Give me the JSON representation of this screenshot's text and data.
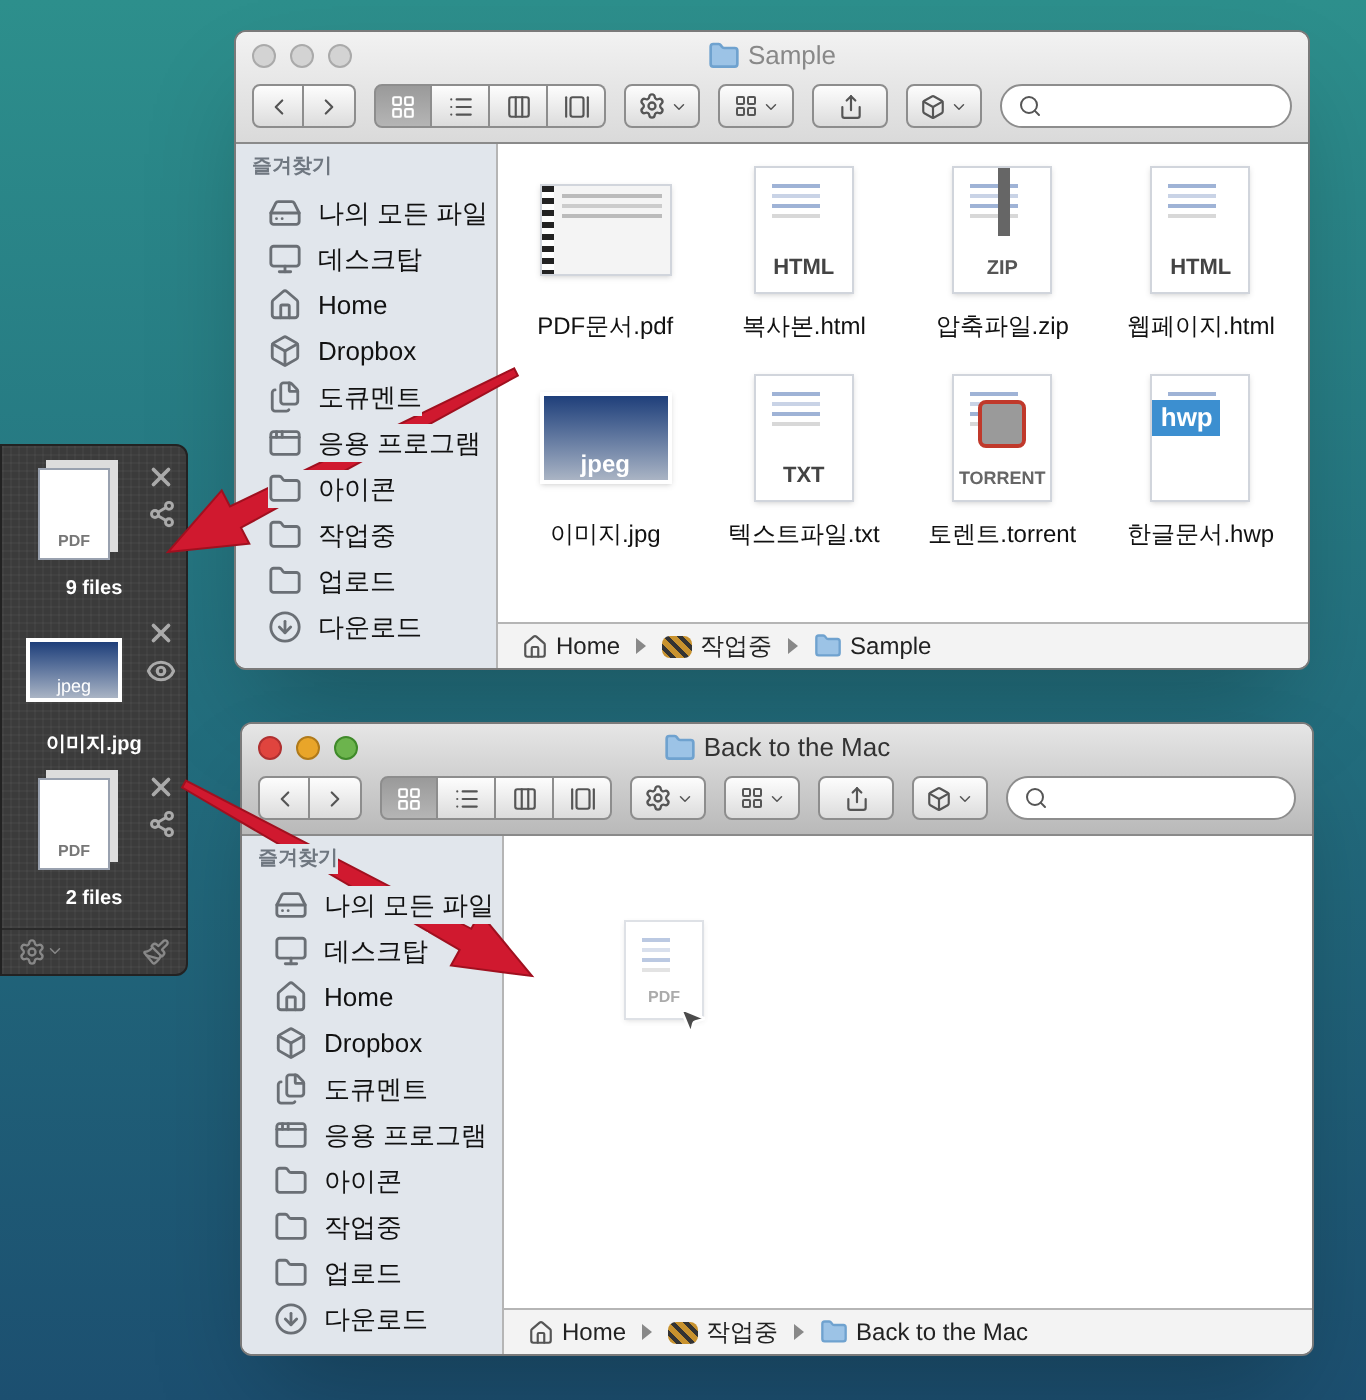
{
  "shelf": {
    "items": [
      {
        "kind": "stack",
        "badge": "PDF",
        "label": "9 files",
        "previewable": false
      },
      {
        "kind": "image",
        "badge": "jpeg",
        "label": "이미지.jpg",
        "previewable": true
      },
      {
        "kind": "stack",
        "badge": "PDF",
        "label": "2 files",
        "previewable": false
      }
    ]
  },
  "windows": [
    {
      "title": "Sample",
      "active": false,
      "view_modes": [
        {
          "selected": true
        },
        {
          "selected": false
        },
        {
          "selected": false
        },
        {
          "selected": false
        }
      ],
      "sidebar": {
        "header": "즐겨찾기",
        "items": [
          {
            "kind": "all-files",
            "label": "나의 모든 파일"
          },
          {
            "kind": "desktop",
            "label": "데스크탑"
          },
          {
            "kind": "home",
            "label": "Home"
          },
          {
            "kind": "dropbox",
            "label": "Dropbox"
          },
          {
            "kind": "documents",
            "label": "도큐멘트"
          },
          {
            "kind": "apps",
            "label": "응용 프로그램"
          },
          {
            "kind": "folder",
            "label": "아이콘"
          },
          {
            "kind": "folder",
            "label": "작업중"
          },
          {
            "kind": "folder",
            "label": "업로드"
          },
          {
            "kind": "downloads",
            "label": "다운로드"
          }
        ]
      },
      "files": [
        {
          "kind": "pdf",
          "name": "PDF문서.pdf"
        },
        {
          "kind": "doc",
          "badge": "HTML",
          "name": "복사본.html"
        },
        {
          "kind": "zip",
          "badge": "ZIP",
          "name": "압축파일.zip"
        },
        {
          "kind": "doc",
          "badge": "HTML",
          "name": "웹페이지.html"
        },
        {
          "kind": "image",
          "badge": "jpeg",
          "name": "이미지.jpg"
        },
        {
          "kind": "doc",
          "badge": "TXT",
          "name": "텍스트파일.txt"
        },
        {
          "kind": "torrent",
          "badge": "TORRENT",
          "name": "토렌트.torrent"
        },
        {
          "kind": "hwp",
          "badge": "hwp",
          "name": "한글문서.hwp"
        }
      ],
      "path": [
        {
          "kind": "home",
          "label": "Home"
        },
        {
          "kind": "striped-folder",
          "label": "작업중"
        },
        {
          "kind": "folder",
          "label": "Sample"
        }
      ]
    },
    {
      "title": "Back to the Mac",
      "active": true,
      "view_modes": [
        {
          "selected": true
        },
        {
          "selected": false
        },
        {
          "selected": false
        },
        {
          "selected": false
        }
      ],
      "sidebar": {
        "header": "즐겨찾기",
        "items": [
          {
            "kind": "all-files",
            "label": "나의 모든 파일"
          },
          {
            "kind": "desktop",
            "label": "데스크탑"
          },
          {
            "kind": "home",
            "label": "Home"
          },
          {
            "kind": "dropbox",
            "label": "Dropbox"
          },
          {
            "kind": "documents",
            "label": "도큐멘트"
          },
          {
            "kind": "apps",
            "label": "응용 프로그램"
          },
          {
            "kind": "folder",
            "label": "아이콘"
          },
          {
            "kind": "folder",
            "label": "작업중"
          },
          {
            "kind": "folder",
            "label": "업로드"
          },
          {
            "kind": "downloads",
            "label": "다운로드"
          }
        ]
      },
      "drag_ghost": {
        "badge": "PDF"
      },
      "path": [
        {
          "kind": "home",
          "label": "Home"
        },
        {
          "kind": "striped-folder",
          "label": "작업중"
        },
        {
          "kind": "folder",
          "label": "Back to the Mac"
        }
      ]
    }
  ]
}
